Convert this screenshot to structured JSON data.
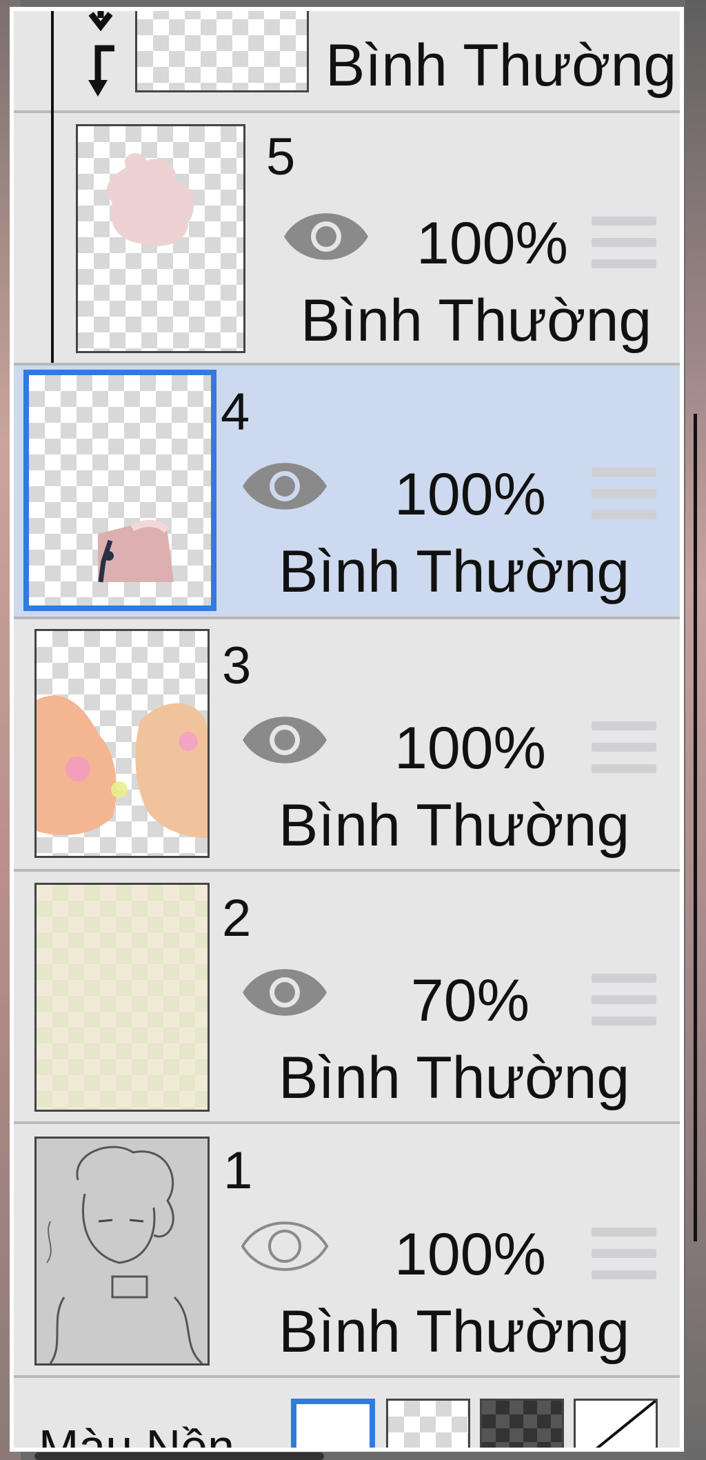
{
  "clip_row": {
    "blend_mode": "Bình Thường"
  },
  "layers": [
    {
      "number": "5",
      "opacity": "100%",
      "blend_mode": "Bình Thường",
      "visible": true,
      "selected": false
    },
    {
      "number": "4",
      "opacity": "100%",
      "blend_mode": "Bình Thường",
      "visible": true,
      "selected": true
    },
    {
      "number": "3",
      "opacity": "100%",
      "blend_mode": "Bình Thường",
      "visible": true,
      "selected": false
    },
    {
      "number": "2",
      "opacity": "70%",
      "blend_mode": "Bình Thường",
      "visible": true,
      "selected": false
    },
    {
      "number": "1",
      "opacity": "100%",
      "blend_mode": "Bình Thường",
      "visible": false,
      "selected": false
    }
  ],
  "background": {
    "label": "Màu Nền",
    "options": [
      "white",
      "checker-light",
      "checker-dark",
      "custom"
    ],
    "selected": "white"
  },
  "colors": {
    "accent": "#2f7be0",
    "selected_row": "#cdd9ee",
    "panel": "#e6e6e6",
    "eye": "#888888"
  }
}
